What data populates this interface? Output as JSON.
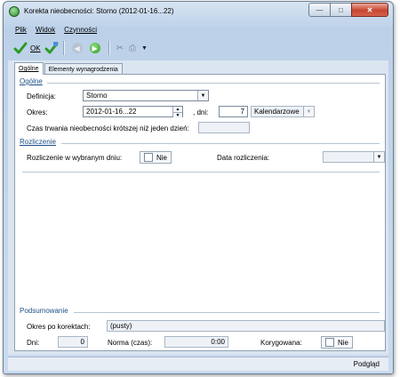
{
  "window": {
    "title": "Korekta nieobecności: Storno (2012-01-16...22)",
    "controls": {
      "minimize": "—",
      "maximize": "□",
      "close": "✕"
    }
  },
  "menu": [
    {
      "label": "Plik"
    },
    {
      "label": "Widok"
    },
    {
      "label": "Czynności"
    }
  ],
  "toolbar": {
    "ok_label": "OK",
    "icons": [
      "check-icon",
      "check-plus-icon",
      "prev-icon",
      "next-icon",
      "delete-icon",
      "print-icon",
      "dropdown-icon"
    ]
  },
  "tabs": [
    {
      "label": "Ogólne",
      "active": true
    },
    {
      "label": "Elementy wynagrodzenia",
      "active": false
    }
  ],
  "general": {
    "heading": "Ogólne",
    "definicja_label": "Definicja:",
    "definicja_value": "Storno",
    "okres_label": "Okres:",
    "okres_value": "2012-01-16...22",
    "dni_label": ", dni:",
    "dni_value": "7",
    "kalendarzowe_value": "Kalendarzowe",
    "czas_label": "Czas trwania nieobecności krótszej niż jeden dzień:",
    "czas_value": ""
  },
  "settlement": {
    "heading": "Rozliczenie",
    "rozliczenie_label": "Rozliczenie w wybranym dniu:",
    "rozliczenie_value": "Nie",
    "data_label": "Data rozliczenia:",
    "data_value": ""
  },
  "summary": {
    "heading": "Podsumowanie",
    "okres_label": "Okres po korektach:",
    "okres_value": "(pusty)",
    "dni_label": "Dni:",
    "dni_value": "0",
    "norma_label": "Norma (czas):",
    "norma_value": "0:00",
    "korygowana_label": "Korygowana:",
    "korygowana_value": "Nie"
  },
  "status": {
    "podglad": "Podgląd"
  },
  "colors": {
    "accent": "#1c4f8a",
    "close_button": "#c7452f",
    "ok_green": "#2c9a22"
  }
}
